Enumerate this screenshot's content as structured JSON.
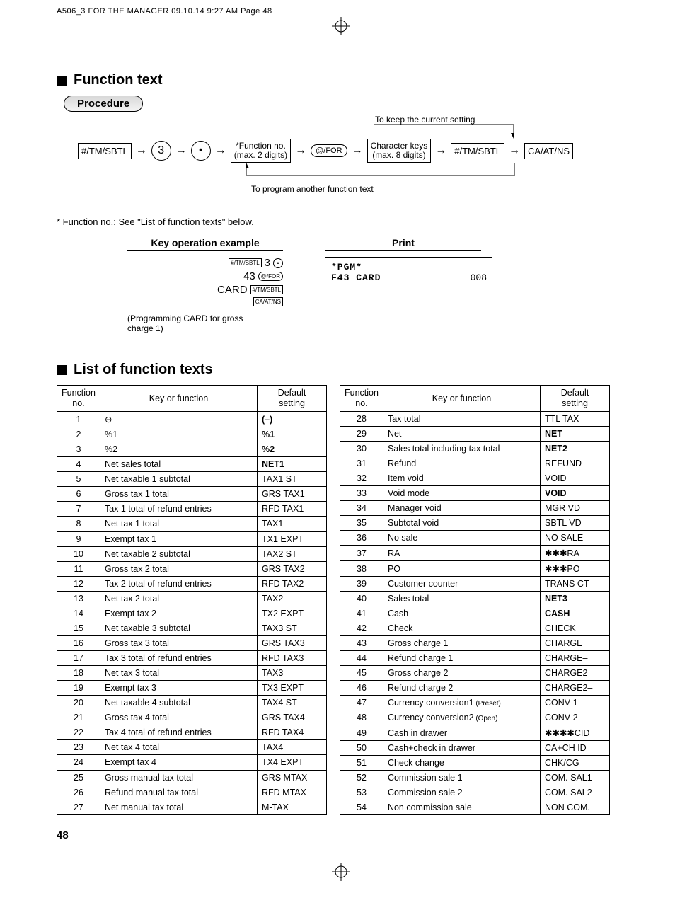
{
  "header": "A506_3 FOR THE MANAGER  09.10.14 9:27 AM  Page 48",
  "section1_title": "Function text",
  "procedure_label": "Procedure",
  "flow": {
    "k1": "#/TM/SBTL",
    "k2": "3",
    "k3": "•",
    "k4a": "*Function no.",
    "k4b": "(max. 2 digits)",
    "k5": "@/FOR",
    "k6a": "Character keys",
    "k6b": "(max. 8 digits)",
    "k7": "#/TM/SBTL",
    "k8": "CA/AT/NS",
    "note_top": "To keep the current setting",
    "note_bottom": "To program another function text"
  },
  "footnote": "* Function no.: See \"List of function texts\" below.",
  "example": {
    "heading": "Key operation example",
    "l1_a": "#/TM/SBTL",
    "l1_b": "3",
    "l1_c": "•",
    "l2_a": "43",
    "l2_b": "@/FOR",
    "l3_a": "CARD",
    "l3_b": "#/TM/SBTL",
    "l4": "CA/AT/NS",
    "note": "(Programming CARD for gross charge 1)"
  },
  "print": {
    "heading": "Print",
    "l1": "*PGM*",
    "l2": "F43 CARD",
    "code": "008"
  },
  "section2_title": "List of function texts",
  "th_fn": "Function\nno.",
  "th_key": "Key or function",
  "th_ds": "Default\nsetting",
  "left_rows": [
    {
      "n": "1",
      "k": "⊖",
      "d": "(–)",
      "b": true
    },
    {
      "n": "2",
      "k": "%1",
      "d": "%1",
      "b": true
    },
    {
      "n": "3",
      "k": "%2",
      "d": "%2",
      "b": true
    },
    {
      "n": "4",
      "k": "Net sales total",
      "d": "NET1",
      "b": true
    },
    {
      "n": "5",
      "k": "Net taxable 1 subtotal",
      "d": "TAX1 ST"
    },
    {
      "n": "6",
      "k": "Gross tax 1 total",
      "d": "GRS TAX1"
    },
    {
      "n": "7",
      "k": "Tax 1 total of refund entries",
      "d": "RFD TAX1"
    },
    {
      "n": "8",
      "k": "Net tax 1 total",
      "d": "TAX1"
    },
    {
      "n": "9",
      "k": "Exempt tax 1",
      "d": "TX1 EXPT"
    },
    {
      "n": "10",
      "k": "Net taxable 2 subtotal",
      "d": "TAX2 ST"
    },
    {
      "n": "11",
      "k": "Gross tax 2 total",
      "d": "GRS TAX2"
    },
    {
      "n": "12",
      "k": "Tax 2 total of refund entries",
      "d": "RFD TAX2"
    },
    {
      "n": "13",
      "k": "Net tax 2 total",
      "d": "TAX2"
    },
    {
      "n": "14",
      "k": "Exempt tax 2",
      "d": "TX2 EXPT"
    },
    {
      "n": "15",
      "k": "Net taxable 3 subtotal",
      "d": "TAX3 ST"
    },
    {
      "n": "16",
      "k": "Gross tax 3 total",
      "d": "GRS TAX3"
    },
    {
      "n": "17",
      "k": "Tax 3 total of refund entries",
      "d": "RFD TAX3"
    },
    {
      "n": "18",
      "k": "Net tax 3 total",
      "d": "TAX3"
    },
    {
      "n": "19",
      "k": "Exempt tax 3",
      "d": "TX3 EXPT"
    },
    {
      "n": "20",
      "k": "Net taxable 4 subtotal",
      "d": "TAX4 ST"
    },
    {
      "n": "21",
      "k": "Gross tax 4 total",
      "d": "GRS TAX4"
    },
    {
      "n": "22",
      "k": "Tax 4 total of refund entries",
      "d": "RFD TAX4"
    },
    {
      "n": "23",
      "k": "Net tax 4 total",
      "d": "TAX4"
    },
    {
      "n": "24",
      "k": "Exempt tax 4",
      "d": "TX4 EXPT"
    },
    {
      "n": "25",
      "k": "Gross manual tax total",
      "d": "GRS MTAX"
    },
    {
      "n": "26",
      "k": "Refund manual tax total",
      "d": "RFD MTAX"
    },
    {
      "n": "27",
      "k": "Net manual tax total",
      "d": "M-TAX"
    }
  ],
  "right_rows": [
    {
      "n": "28",
      "k": "Tax total",
      "d": "TTL TAX"
    },
    {
      "n": "29",
      "k": "Net",
      "d": "NET",
      "b": true
    },
    {
      "n": "30",
      "k": "Sales total including tax total",
      "d": "NET2",
      "b": true
    },
    {
      "n": "31",
      "k": "Refund",
      "d": "REFUND"
    },
    {
      "n": "32",
      "k": "Item void",
      "d": "VOID"
    },
    {
      "n": "33",
      "k": "Void mode",
      "d": "VOID",
      "b": true
    },
    {
      "n": "34",
      "k": "Manager void",
      "d": "MGR VD"
    },
    {
      "n": "35",
      "k": "Subtotal void",
      "d": "SBTL VD"
    },
    {
      "n": "36",
      "k": "No sale",
      "d": "NO SALE"
    },
    {
      "n": "37",
      "k": "RA",
      "d": "✱✱✱RA"
    },
    {
      "n": "38",
      "k": "PO",
      "d": "✱✱✱PO"
    },
    {
      "n": "39",
      "k": "Customer counter",
      "d": "TRANS CT"
    },
    {
      "n": "40",
      "k": "Sales total",
      "d": "NET3",
      "b": true
    },
    {
      "n": "41",
      "k": "Cash",
      "d": "CASH",
      "b": true
    },
    {
      "n": "42",
      "k": "Check",
      "d": "CHECK"
    },
    {
      "n": "43",
      "k": "Gross charge 1",
      "d": "CHARGE"
    },
    {
      "n": "44",
      "k": "Refund charge 1",
      "d": "CHARGE–"
    },
    {
      "n": "45",
      "k": "Gross charge 2",
      "d": "CHARGE2"
    },
    {
      "n": "46",
      "k": "Refund charge 2",
      "d": "CHARGE2–"
    },
    {
      "n": "47",
      "k": "Currency conversion1",
      "tail": "(Preset)",
      "d": "CONV 1"
    },
    {
      "n": "48",
      "k": "Currency conversion2",
      "tail": "(Open)",
      "d": "CONV 2"
    },
    {
      "n": "49",
      "k": "Cash in drawer",
      "d": "✱✱✱✱CID"
    },
    {
      "n": "50",
      "k": "Cash+check in drawer",
      "d": "CA+CH ID"
    },
    {
      "n": "51",
      "k": "Check change",
      "d": "CHK/CG"
    },
    {
      "n": "52",
      "k": "Commission sale 1",
      "d": "COM. SAL1"
    },
    {
      "n": "53",
      "k": "Commission sale 2",
      "d": "COM. SAL2"
    },
    {
      "n": "54",
      "k": "Non commission sale",
      "d": "NON COM."
    }
  ],
  "page_number": "48"
}
